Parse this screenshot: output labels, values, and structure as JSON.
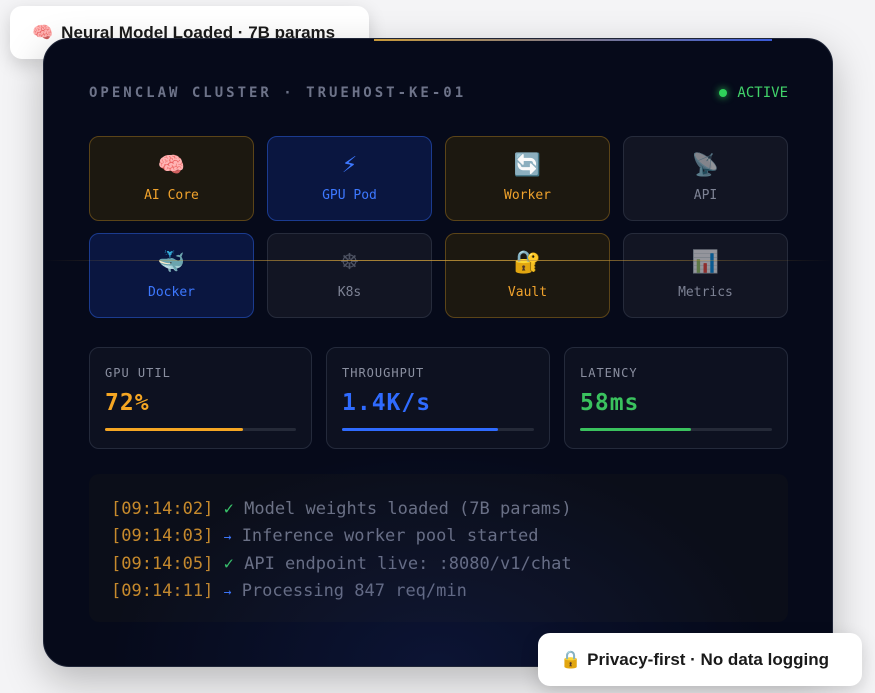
{
  "badges": {
    "top": {
      "icon": "brain-icon",
      "glyph": "🧠",
      "text": "Neural Model Loaded · 7B params"
    },
    "bottom": {
      "icon": "lock-icon",
      "glyph": "🔒",
      "text": "Privacy-first · No data logging"
    }
  },
  "panel": {
    "title": "OPENCLAW CLUSTER · TRUEHOST-KE-01",
    "status": {
      "label": "ACTIVE",
      "color": "#2fd15a"
    }
  },
  "tiles": [
    {
      "label": "AI Core",
      "icon": "brain-icon",
      "glyph": "🧠",
      "style": "amber"
    },
    {
      "label": "GPU Pod",
      "icon": "lightning-icon",
      "glyph": "⚡",
      "style": "blue"
    },
    {
      "label": "Worker",
      "icon": "refresh-icon",
      "glyph": "🔄",
      "style": "amber"
    },
    {
      "label": "API",
      "icon": "satellite-dish-icon",
      "glyph": "📡",
      "style": "gray"
    },
    {
      "label": "Docker",
      "icon": "whale-icon",
      "glyph": "🐳",
      "style": "blue"
    },
    {
      "label": "K8s",
      "icon": "helm-wheel-icon",
      "glyph": "☸",
      "style": "gray"
    },
    {
      "label": "Vault",
      "icon": "lock-icon",
      "glyph": "🔐",
      "style": "amber"
    },
    {
      "label": "Metrics",
      "icon": "bar-chart-icon",
      "glyph": "📊",
      "style": "gray"
    }
  ],
  "metrics": [
    {
      "label": "GPU UTIL",
      "value": "72%",
      "progress": 0.72,
      "color": "#f5a623"
    },
    {
      "label": "THROUGHPUT",
      "value": "1.4K/s",
      "progress": 0.81,
      "color": "#2f6bff"
    },
    {
      "label": "LATENCY",
      "value": "58ms",
      "progress": 0.58,
      "color": "#3ac25e"
    }
  ],
  "log": [
    {
      "time": "[09:14:02]",
      "mark": "✓",
      "mark_type": "check",
      "message": "Model weights loaded (7B params)"
    },
    {
      "time": "[09:14:03]",
      "mark": "→",
      "mark_type": "arrow",
      "message": "Inference worker pool started"
    },
    {
      "time": "[09:14:05]",
      "mark": "✓",
      "mark_type": "check",
      "message": "API endpoint live: :8080/v1/chat"
    },
    {
      "time": "[09:14:11]",
      "mark": "→",
      "mark_type": "arrow",
      "message": "Processing 847 req/min"
    }
  ]
}
